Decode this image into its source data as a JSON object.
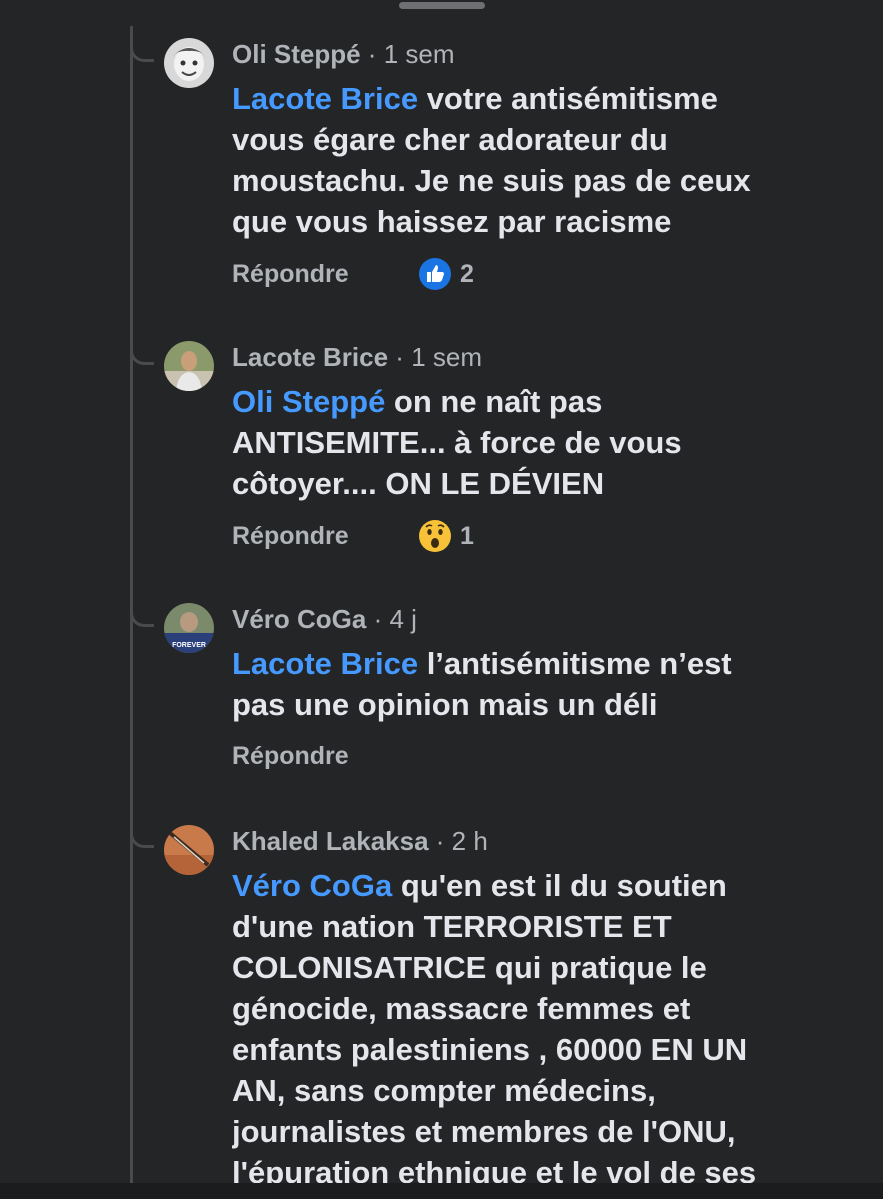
{
  "comments": [
    {
      "author": "Oli Steppé",
      "dot": " · ",
      "time": "1 sem",
      "mention": "Lacote Brice",
      "text": " votre antisémitisme\nvous égare cher adorateur du\nmoustachu.  Je ne suis pas de ceux\nque vous haissez par racisme",
      "reply_label": "Répondre",
      "reaction": {
        "icon": "like-reaction-icon",
        "count": "2"
      }
    },
    {
      "author": "Lacote Brice",
      "dot": " · ",
      "time": "1 sem",
      "mention": "Oli Steppé",
      "text": " on ne naît pas\nANTISEMITE... à force de vous\ncôtoyer.... ON LE DÉVIEN",
      "reply_label": "Répondre",
      "reaction": {
        "icon": "wow-reaction-icon",
        "count": "1"
      }
    },
    {
      "author": "Véro CoGa",
      "dot": " · ",
      "time": "4 j",
      "mention": "Lacote Brice",
      "text": " l’antisémitisme n’est\npas une opinion mais un déli",
      "reply_label": "Répondre",
      "avatar_caption": "FOREVER"
    },
    {
      "author": "Khaled Lakaksa",
      "dot": " · ",
      "time": "2 h",
      "mention": "Véro CoGa",
      "text": " qu'en est il du soutien\nd'une nation TERRORISTE ET\nCOLONISATRICE qui pratique le\ngénocide, massacre femmes et\nenfants palestiniens , 60000 EN UN\nAN, sans compter médecins,\njournalistes et membres de l'ONU,\nl'épuration ethnique et le vol de ses"
    }
  ],
  "colors": {
    "background": "#242526",
    "mention": "#4599ff",
    "meta": "#b0b3b8",
    "text": "#e4e6eb"
  }
}
